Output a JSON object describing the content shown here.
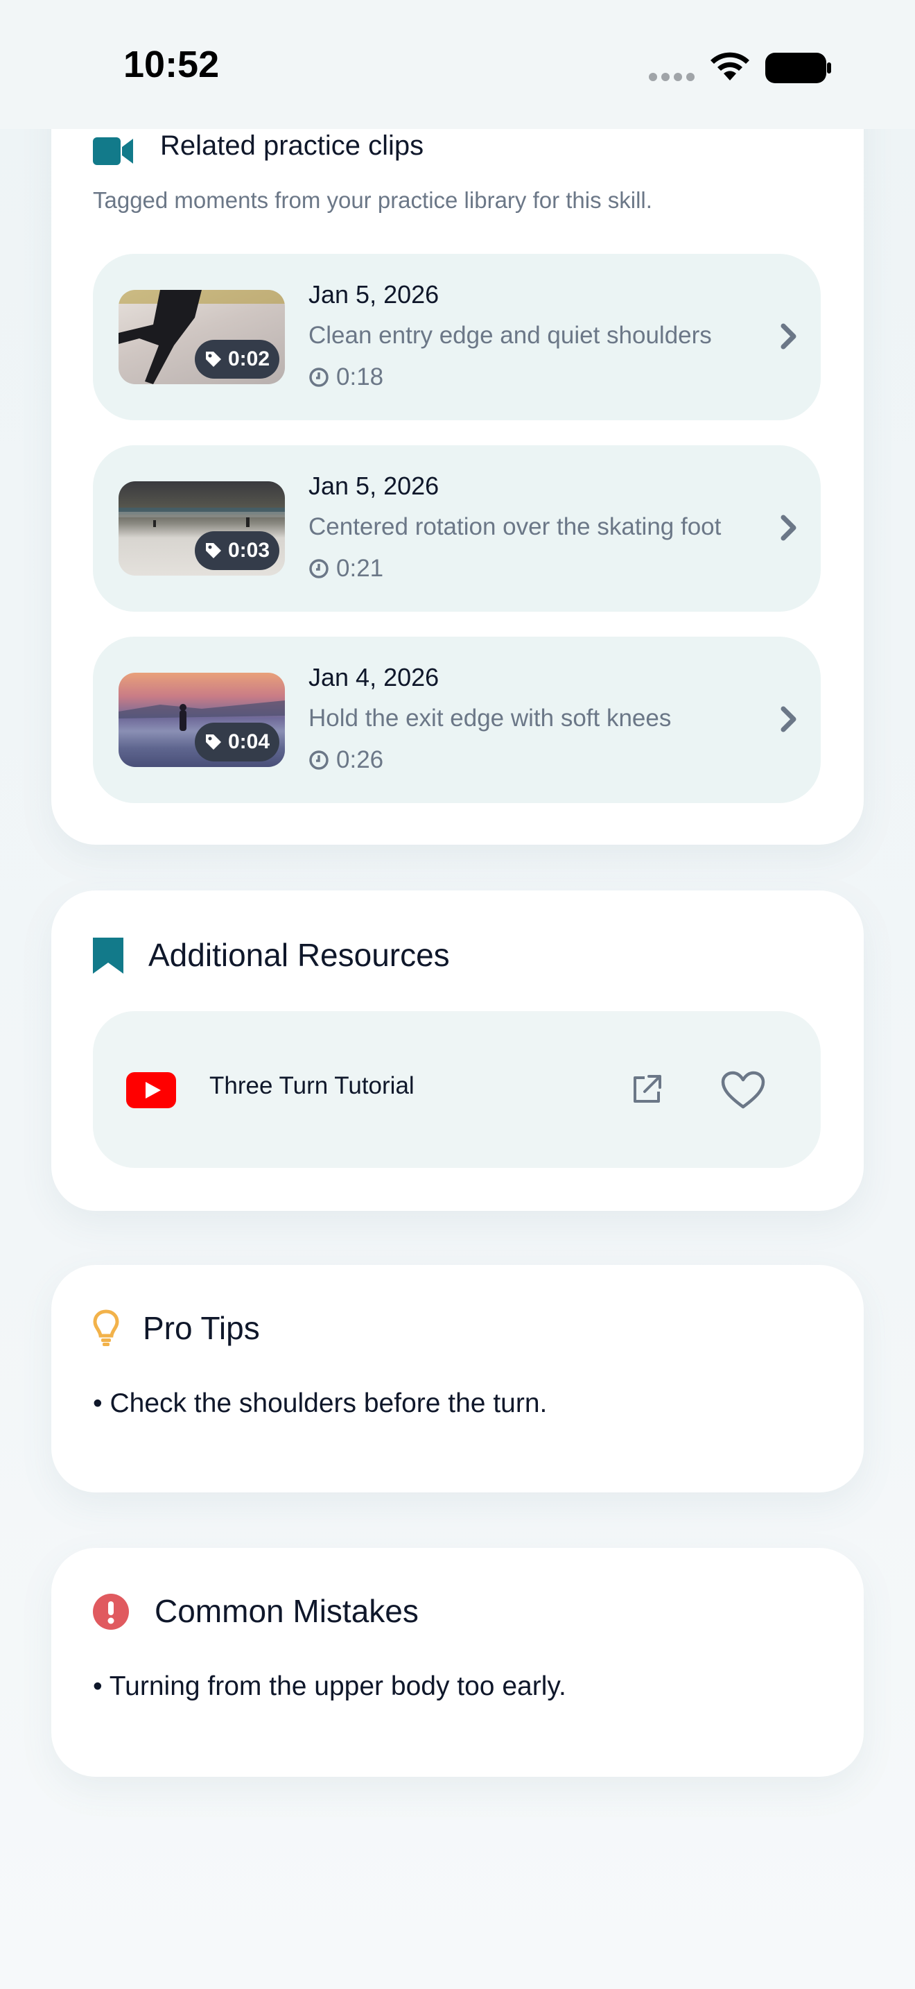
{
  "status_bar": {
    "time": "10:52"
  },
  "clips_section": {
    "title": "Related practice clips",
    "subtitle": "Tagged moments from your practice library for this skill.",
    "clips": [
      {
        "tag_time": "0:02",
        "date": "Jan 5, 2026",
        "description": "Clean entry edge and quiet shoulders",
        "duration": "0:18"
      },
      {
        "tag_time": "0:03",
        "date": "Jan 5, 2026",
        "description": "Centered rotation over the skating foot",
        "duration": "0:21"
      },
      {
        "tag_time": "0:04",
        "date": "Jan 4, 2026",
        "description": "Hold the exit edge with soft knees",
        "duration": "0:26"
      }
    ]
  },
  "resources_section": {
    "title": "Additional Resources",
    "items": [
      {
        "label": "Three Turn Tutorial",
        "source_icon": "youtube-icon"
      }
    ]
  },
  "tips_section": {
    "title": "Pro Tips",
    "items": [
      "• Check the shoulders before the turn."
    ]
  },
  "mistakes_section": {
    "title": "Common Mistakes",
    "items": [
      "• Turning from the upper body too early."
    ]
  },
  "colors": {
    "accent": "#127a8a",
    "tip": "#f2b24a",
    "mistake": "#e05a5f",
    "youtube": "#ff0000"
  }
}
